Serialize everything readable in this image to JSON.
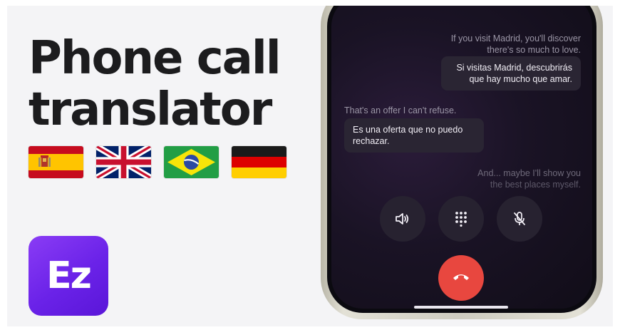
{
  "headline": {
    "line1": "Phone call",
    "line2": "translator"
  },
  "flags": [
    {
      "name": "spain-flag-icon"
    },
    {
      "name": "uk-flag-icon"
    },
    {
      "name": "brazil-flag-icon"
    },
    {
      "name": "germany-flag-icon"
    }
  ],
  "logo": {
    "text": "Ez"
  },
  "conversation": {
    "m1_original_l1": "If you visit Madrid, you'll discover",
    "m1_original_l2": "there's so much to love.",
    "m1_translation_l1": "Si visitas Madrid, descubrirás",
    "m1_translation_l2": "que hay mucho que amar.",
    "m2_original": "That's an offer I can't refuse.",
    "m2_translation_l1": "Es una oferta que no puedo",
    "m2_translation_l2": "rechazar.",
    "m3_original_l1": "And... maybe I'll show you",
    "m3_original_l2": "the best places myself."
  },
  "colors": {
    "logo_gradient_start": "#8a3cf5",
    "logo_gradient_end": "#5a16d8",
    "hangup_red": "#e8473f",
    "screen_bg": "#1a1325"
  },
  "controls": {
    "speaker": "speaker-icon",
    "keypad": "keypad-icon",
    "mute": "mic-off-icon",
    "hangup": "hang-up-icon"
  }
}
